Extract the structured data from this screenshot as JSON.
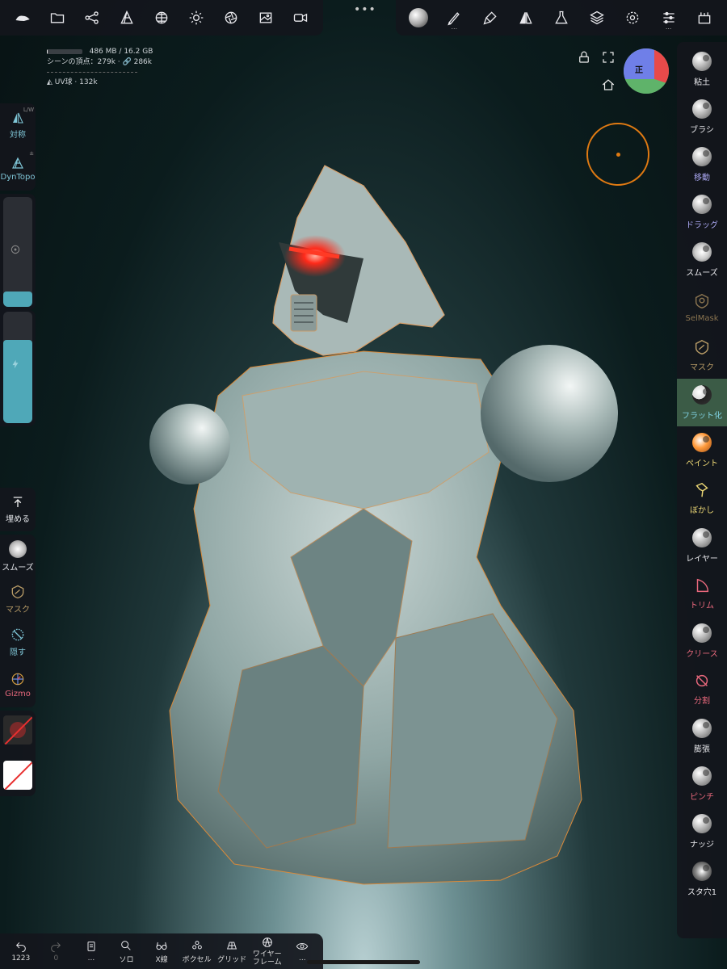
{
  "colors": {
    "accent_blue": "#7fc5d6",
    "accent_purple": "#a9a6f0",
    "accent_orange": "#e07a12",
    "accent_yellow": "#ead574",
    "accent_pink": "#e8687c",
    "selected_bg": "#3b5b46",
    "eye_glow": "#ff2a1a"
  },
  "stats": {
    "memory": "486 MB / 16.2 GB",
    "memory_fraction": 0.03,
    "scene_vertices": "シーンの頂点：279k · 🔗 286k",
    "mesh_name": "UV球",
    "mesh_count": "· 132k"
  },
  "top_left_toolbar": [
    {
      "name": "hat-icon"
    },
    {
      "name": "folder-icon"
    },
    {
      "name": "scene-graph-icon"
    },
    {
      "name": "topology-icon"
    },
    {
      "name": "material-sphere-icon"
    },
    {
      "name": "light-icon"
    },
    {
      "name": "camera-shutter-icon"
    },
    {
      "name": "image-icon"
    },
    {
      "name": "video-icon"
    }
  ],
  "top_right_toolbar": [
    {
      "name": "matcap-icon"
    },
    {
      "name": "stroke-icon"
    },
    {
      "name": "paint-brush-icon"
    },
    {
      "name": "symmetry-icon"
    },
    {
      "name": "flask-icon"
    },
    {
      "name": "layers-icon"
    },
    {
      "name": "settings-icon"
    },
    {
      "name": "sliders-icon"
    },
    {
      "name": "toolbox-icon"
    }
  ],
  "view_cube": {
    "label": "正"
  },
  "left_top": {
    "symmetry": {
      "label": "対称",
      "corner": "L/W"
    },
    "dyntopo": {
      "label": "DynTopo",
      "corner": "±"
    }
  },
  "sliders": {
    "radius": 0.14,
    "intensity": 0.75
  },
  "left_bury": {
    "label": "埋める"
  },
  "left_tools": [
    {
      "key": "smooth",
      "label": "スムーズ"
    },
    {
      "key": "mask",
      "label": "マスク"
    },
    {
      "key": "hide",
      "label": "隠す"
    },
    {
      "key": "gizmo",
      "label": "Gizmo"
    }
  ],
  "right_tools": [
    {
      "key": "clay",
      "label": "粘土"
    },
    {
      "key": "brush",
      "label": "ブラシ"
    },
    {
      "key": "move",
      "label": "移動"
    },
    {
      "key": "drag",
      "label": "ドラッグ"
    },
    {
      "key": "smooth",
      "label": "スムーズ"
    },
    {
      "key": "selmask",
      "label": "SelMask"
    },
    {
      "key": "mask",
      "label": "マスク"
    },
    {
      "key": "flatten",
      "label": "フラット化"
    },
    {
      "key": "paint",
      "label": "ペイント"
    },
    {
      "key": "blur",
      "label": "ぼかし"
    },
    {
      "key": "layer",
      "label": "レイヤー"
    },
    {
      "key": "trim",
      "label": "トリム"
    },
    {
      "key": "crease",
      "label": "クリース"
    },
    {
      "key": "split",
      "label": "分割"
    },
    {
      "key": "inflate",
      "label": "膨張"
    },
    {
      "key": "pinch",
      "label": "ピンチ"
    },
    {
      "key": "nudge",
      "label": "ナッジ"
    },
    {
      "key": "stamp",
      "label": "スタ穴1"
    }
  ],
  "bottom_bar": [
    {
      "key": "undo",
      "label": "1223"
    },
    {
      "key": "redo",
      "label": "0"
    },
    {
      "key": "history",
      "label": "..."
    },
    {
      "key": "solo",
      "label": "ソロ"
    },
    {
      "key": "xray",
      "label": "X線"
    },
    {
      "key": "voxel",
      "label": "ボクセル"
    },
    {
      "key": "grid",
      "label": "グリッド"
    },
    {
      "key": "wireframe",
      "label": "ワイヤーフレーム"
    },
    {
      "key": "view",
      "label": "..."
    }
  ],
  "tb_dots": "...",
  "more_dots": "•••"
}
